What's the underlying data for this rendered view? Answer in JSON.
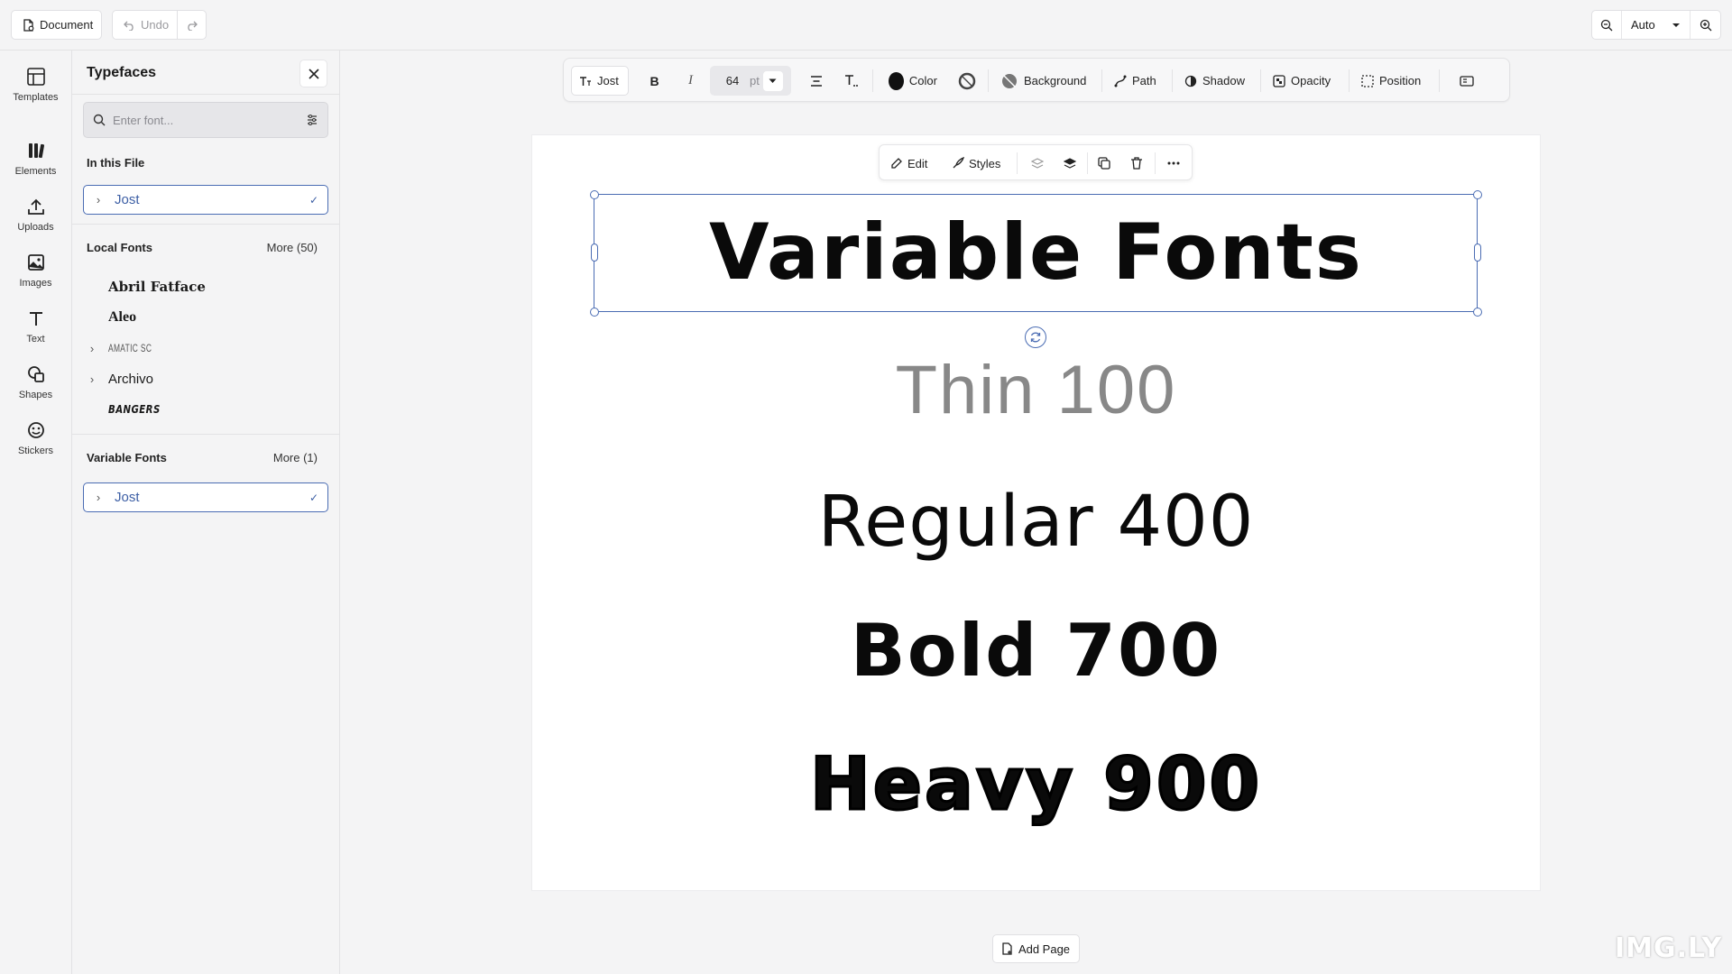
{
  "topbar": {
    "document_label": "Document",
    "undo_label": "Undo",
    "zoom_value": "Auto"
  },
  "rail": {
    "items": [
      {
        "label": "Templates",
        "icon": "templates-icon"
      },
      {
        "label": "Elements",
        "icon": "elements-icon"
      },
      {
        "label": "Uploads",
        "icon": "upload-icon"
      },
      {
        "label": "Images",
        "icon": "image-icon"
      },
      {
        "label": "Text",
        "icon": "text-icon"
      },
      {
        "label": "Shapes",
        "icon": "shapes-icon"
      },
      {
        "label": "Stickers",
        "icon": "sticker-icon"
      }
    ]
  },
  "panel": {
    "title": "Typefaces",
    "search_placeholder": "Enter font...",
    "in_file_label": "In this File",
    "in_file_font": "Jost",
    "local_fonts_label": "Local Fonts",
    "local_fonts_more": "More (50)",
    "local_fonts": [
      "Abril Fatface",
      "Aleo",
      "Amatic SC",
      "Archivo",
      "Bangers"
    ],
    "variable_fonts_label": "Variable Fonts",
    "variable_fonts_more": "More (1)",
    "variable_font": "Jost"
  },
  "toolbar": {
    "font_label": "Jost",
    "font_size": "64",
    "font_unit": "pt",
    "color_label": "Color",
    "background_label": "Background",
    "path_label": "Path",
    "shadow_label": "Shadow",
    "opacity_label": "Opacity",
    "position_label": "Position",
    "color_swatch": "#111111"
  },
  "context_menu": {
    "edit_label": "Edit",
    "styles_label": "Styles"
  },
  "canvas": {
    "title": "Variable Fonts",
    "lines": [
      "Thin 100",
      "Regular 400",
      "Bold 700",
      "Heavy 900"
    ]
  },
  "add_page_label": "Add Page",
  "watermark": "IMG.LY",
  "colors": {
    "accent": "#4a6cb3",
    "background": "#f4f4f5"
  }
}
